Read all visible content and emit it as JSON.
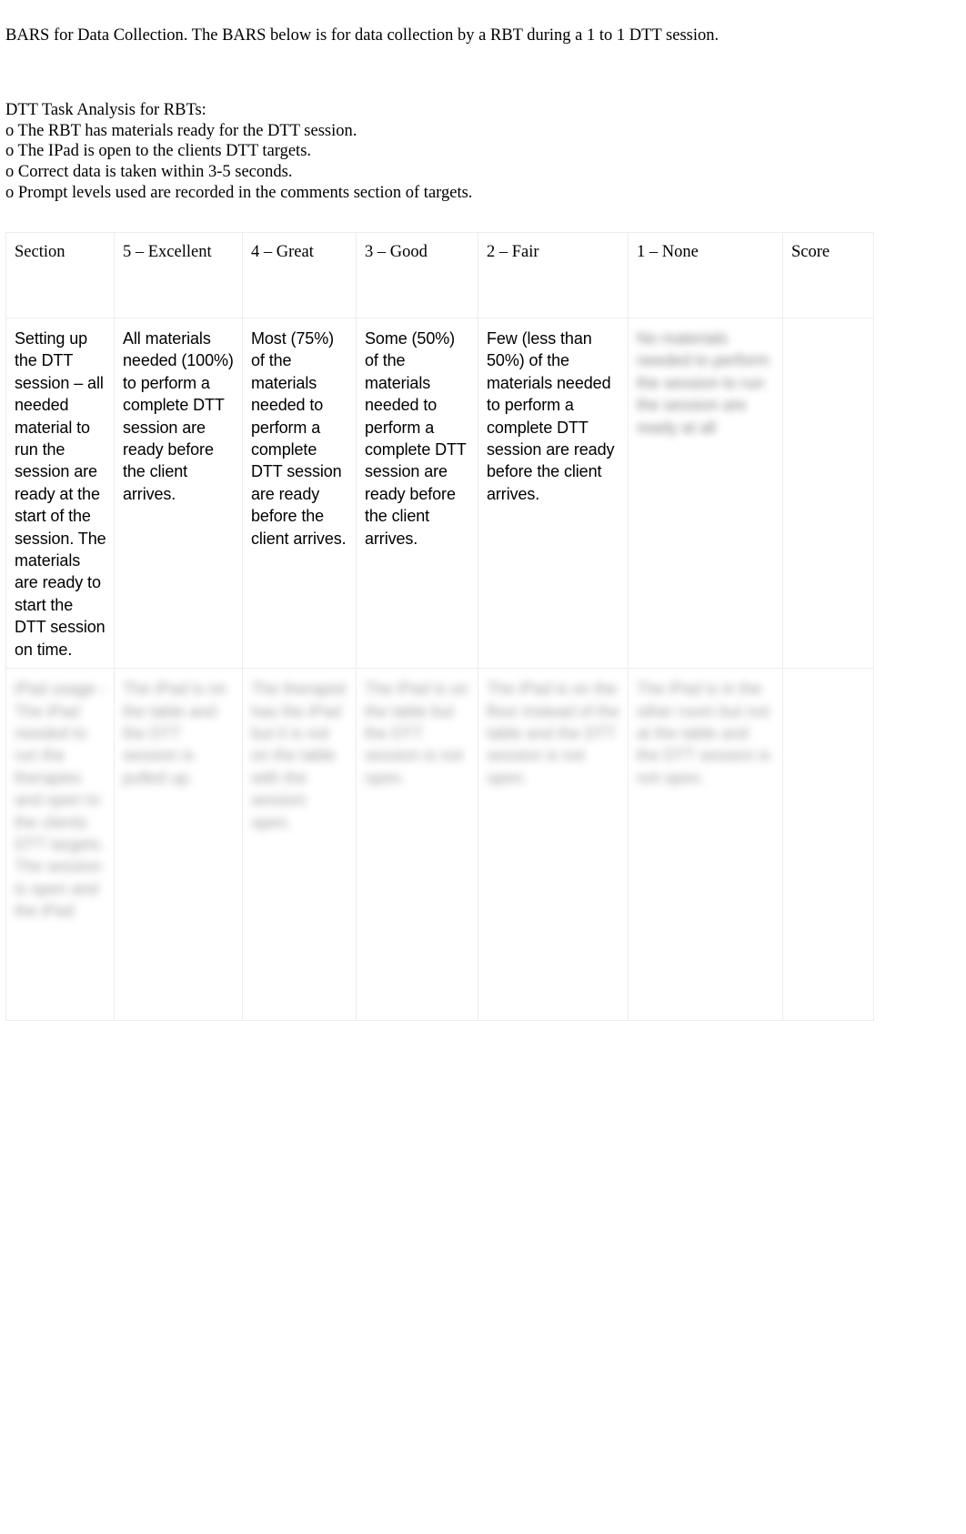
{
  "document": {
    "intro_paragraph": "BARS for Data Collection. The BARS below is for data collection by a RBT during a 1 to 1 DTT session.",
    "task_analysis_title": "DTT Task Analysis for RBTs:",
    "task_analysis_items": [
      "o The RBT has materials ready for the DTT session.",
      "o The IPad is open to the clients DTT targets.",
      "o Correct data is taken within 3-5 seconds.",
      "o Prompt levels used are recorded in the comments section of targets."
    ]
  },
  "table": {
    "headers": [
      "Section",
      "5 – Excellent",
      "4 – Great",
      "3 – Good",
      "2 – Fair",
      "1 – None",
      "Score"
    ],
    "rows": [
      {
        "section": "Setting up the DTT session – all needed material to run the session are ready at the start of the session. The materials are ready to start the DTT session on time.",
        "excellent": "All materials needed (100%) to perform a complete DTT session are ready before the client arrives.",
        "great": "Most (75%) of the materials needed to perform a complete DTT session are ready before the client arrives.",
        "good": "Some (50%) of the materials needed to perform a complete DTT session are ready before the client arrives.",
        "fair": "Few (less than 50%) of the materials needed to perform a complete DTT session are ready before the client arrives.",
        "none": "No materials needed to perform the session to run the session are ready at all",
        "score": ""
      },
      {
        "section": "iPad usage - The iPad needed to run the therapies and open to the clients DTT targets. The session is open and the iPad",
        "excellent": "The iPad is on the table and the DTT session is pulled up.",
        "great": "The therapist has the iPad but it is not on the table with the session open.",
        "good": "The iPad is on the table but the DTT session is not open.",
        "fair": "The iPad is on the floor instead of the table and the DTT session is not open.",
        "none": "The iPad is in the other room but not at the table and the DTT session is not open.",
        "score": ""
      }
    ]
  }
}
